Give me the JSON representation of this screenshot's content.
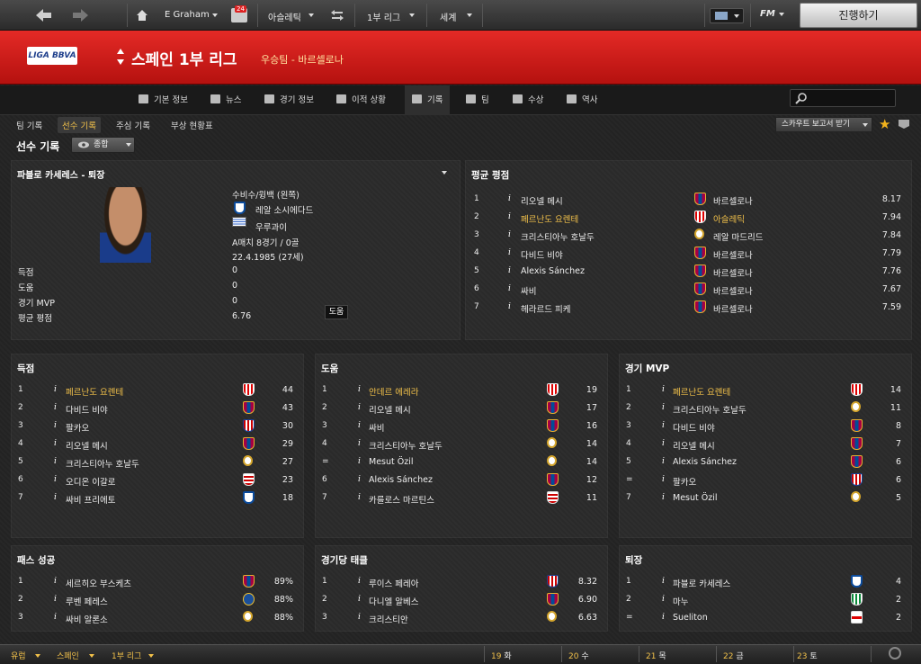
{
  "topbar": {
    "manager": "E Graham",
    "inbox_count": "24",
    "club": "아슬레틱",
    "competition": "1부 리그",
    "world": "세계",
    "fm": "FM",
    "continue": "진행하기"
  },
  "header": {
    "logo": "LIGA BBVA",
    "title": "스페인 1부 리그",
    "subtitle": "우승팀 - 바르셀로나"
  },
  "tabs": [
    "기본 정보",
    "뉴스",
    "경기 정보",
    "이적 상황",
    "기록",
    "팀",
    "수상",
    "역사"
  ],
  "subnav": {
    "items": [
      "팀 기록",
      "선수 기록",
      "주심 기록",
      "부상 현황표"
    ],
    "scout": "스카우트 보고서 받기"
  },
  "section": {
    "title": "선수 기록",
    "view": "종합"
  },
  "player": {
    "name": "파블로 카세레스 - 퇴장",
    "position": "수비수/윙백 (왼쪽)",
    "club": "레알 소시에다드",
    "nation": "우루과이",
    "apps": "A매치 8경기 / 0골",
    "dob": "22.4.1985 (27세)",
    "stats": [
      {
        "label": "득점",
        "value": "0"
      },
      {
        "label": "도움",
        "value": "0"
      },
      {
        "label": "경기 MVP",
        "value": "0"
      },
      {
        "label": "평균 평점",
        "value": "6.76"
      }
    ],
    "tooltip": "도움"
  },
  "avg_rating": {
    "title": "평균 평점",
    "rows": [
      {
        "rank": "1",
        "name": "리오넬 메시",
        "club": "바르셀로나",
        "crest": "bar",
        "value": "8.17",
        "gold": false,
        "club_gold": false
      },
      {
        "rank": "2",
        "name": "페르난도 요렌테",
        "club": "아슬레틱",
        "crest": "ath",
        "value": "7.94",
        "gold": true,
        "club_gold": true
      },
      {
        "rank": "3",
        "name": "크리스티아누 호날두",
        "club": "레알 마드리드",
        "crest": "rm",
        "value": "7.84",
        "gold": false,
        "club_gold": false
      },
      {
        "rank": "4",
        "name": "다비드 비야",
        "club": "바르셀로나",
        "crest": "bar",
        "value": "7.79",
        "gold": false,
        "club_gold": false
      },
      {
        "rank": "5",
        "name": "Alexis Sánchez",
        "club": "바르셀로나",
        "crest": "bar",
        "value": "7.76",
        "gold": false,
        "club_gold": false
      },
      {
        "rank": "6",
        "name": "싸비",
        "club": "바르셀로나",
        "crest": "bar",
        "value": "7.67",
        "gold": false,
        "club_gold": false
      },
      {
        "rank": "7",
        "name": "헤라르드 피케",
        "club": "바르셀로나",
        "crest": "bar",
        "value": "7.59",
        "gold": false,
        "club_gold": false
      }
    ]
  },
  "goals": {
    "title": "득점",
    "rows": [
      {
        "rank": "1",
        "name": "페르난도 요렌테",
        "crest": "ath",
        "value": "44",
        "gold": true
      },
      {
        "rank": "2",
        "name": "다비드 비야",
        "crest": "bar",
        "value": "43",
        "gold": false
      },
      {
        "rank": "3",
        "name": "팔카오",
        "crest": "atm",
        "value": "30",
        "gold": false
      },
      {
        "rank": "4",
        "name": "리오넬 메시",
        "crest": "bar",
        "value": "29",
        "gold": false
      },
      {
        "rank": "5",
        "name": "크리스티아누 호날두",
        "crest": "rm",
        "value": "27",
        "gold": false
      },
      {
        "rank": "6",
        "name": "오디온 이갈로",
        "crest": "gra",
        "value": "23",
        "gold": false
      },
      {
        "rank": "7",
        "name": "싸비 프리에토",
        "crest": "rso",
        "value": "18",
        "gold": false
      }
    ]
  },
  "assists": {
    "title": "도움",
    "rows": [
      {
        "rank": "1",
        "name": "안데르 에레라",
        "crest": "ath",
        "value": "19",
        "gold": true
      },
      {
        "rank": "2",
        "name": "리오넬 메시",
        "crest": "bar",
        "value": "17",
        "gold": false
      },
      {
        "rank": "3",
        "name": "싸비",
        "crest": "bar",
        "value": "16",
        "gold": false
      },
      {
        "rank": "4",
        "name": "크리스티아누 호날두",
        "crest": "rm",
        "value": "14",
        "gold": false
      },
      {
        "rank": "=",
        "name": "Mesut Özil",
        "crest": "rm",
        "value": "14",
        "gold": false
      },
      {
        "rank": "6",
        "name": "Alexis Sánchez",
        "crest": "bar",
        "value": "12",
        "gold": false
      },
      {
        "rank": "7",
        "name": "카를로스 마르틴스",
        "crest": "gra",
        "value": "11",
        "gold": false
      }
    ]
  },
  "mvp": {
    "title": "경기 MVP",
    "rows": [
      {
        "rank": "1",
        "name": "페르난도 요렌테",
        "crest": "ath",
        "value": "14",
        "gold": true
      },
      {
        "rank": "2",
        "name": "크리스티아누 호날두",
        "crest": "rm",
        "value": "11",
        "gold": false
      },
      {
        "rank": "3",
        "name": "다비드 비야",
        "crest": "bar",
        "value": "8",
        "gold": false
      },
      {
        "rank": "4",
        "name": "리오넬 메시",
        "crest": "bar",
        "value": "7",
        "gold": false
      },
      {
        "rank": "5",
        "name": "Alexis Sánchez",
        "crest": "bar",
        "value": "6",
        "gold": false
      },
      {
        "rank": "=",
        "name": "팔카오",
        "crest": "atm",
        "value": "6",
        "gold": false
      },
      {
        "rank": "7",
        "name": "Mesut Özil",
        "crest": "rm",
        "value": "5",
        "gold": false
      }
    ]
  },
  "passes": {
    "title": "패스 성공",
    "rows": [
      {
        "rank": "1",
        "name": "세르히오 부스케츠",
        "crest": "bar",
        "value": "89%",
        "gold": false
      },
      {
        "rank": "2",
        "name": "루벤 페레스",
        "crest": "get",
        "value": "88%",
        "gold": false
      },
      {
        "rank": "3",
        "name": "싸비 알론소",
        "crest": "rm",
        "value": "88%",
        "gold": false
      }
    ]
  },
  "tackles": {
    "title": "경기당 태클",
    "rows": [
      {
        "rank": "1",
        "name": "루이스 페레아",
        "crest": "atm",
        "value": "8.32",
        "gold": false
      },
      {
        "rank": "2",
        "name": "다니엘 알베스",
        "crest": "bar",
        "value": "6.90",
        "gold": false
      },
      {
        "rank": "3",
        "name": "크리스티안",
        "crest": "esp",
        "value": "6.63",
        "gold": false
      }
    ]
  },
  "redcards": {
    "title": "퇴장",
    "rows": [
      {
        "rank": "1",
        "name": "파블로 카세레스",
        "crest": "rso",
        "value": "4",
        "gold": false
      },
      {
        "rank": "2",
        "name": "마누",
        "crest": "bet",
        "value": "2",
        "gold": false
      },
      {
        "rank": "=",
        "name": "Sueliton",
        "crest": "ray",
        "value": "2",
        "gold": false
      }
    ]
  },
  "bottom": {
    "crumbs": [
      "유럽",
      "스페인",
      "1부 리그"
    ],
    "days": [
      {
        "d": "19",
        "w": "화"
      },
      {
        "d": "20",
        "w": "수"
      },
      {
        "d": "21",
        "w": "목"
      },
      {
        "d": "22",
        "w": "금"
      },
      {
        "d": "23",
        "w": "토"
      }
    ]
  }
}
